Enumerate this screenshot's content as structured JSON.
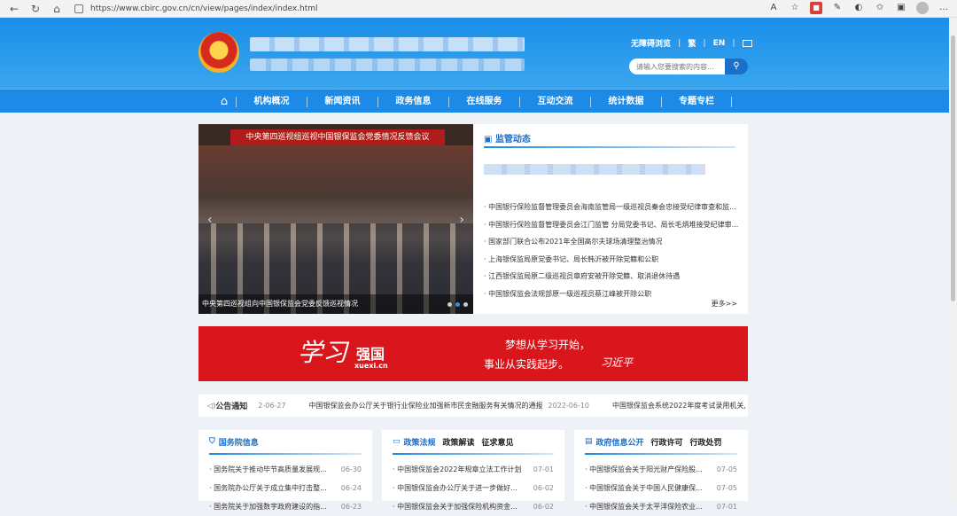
{
  "browser": {
    "url": "https://www.cbirc.gov.cn/cn/view/pages/index/index.html",
    "icons": [
      "back-icon",
      "refresh-icon",
      "home-icon",
      "lock-icon",
      "read-aloud-icon",
      "favorite-icon",
      "pdf-icon",
      "collections-icon",
      "extensions-icon",
      "favorites-bar-icon",
      "sidebar-icon",
      "profile-icon",
      "more-icon"
    ]
  },
  "header": {
    "top_links": [
      "无障碍浏览",
      "繁",
      "EN"
    ],
    "search_placeholder": "请输入您要搜索的内容..."
  },
  "nav": {
    "items": [
      "机构概况",
      "新闻资讯",
      "政务信息",
      "在线服务",
      "互动交流",
      "统计数据",
      "专题专栏"
    ]
  },
  "slider": {
    "banner": "中央第四巡视组巡视中国银保监会党委情况反馈会议",
    "caption": "中央第四巡视组向中国银保监会党委反馈巡视情况"
  },
  "news": {
    "title": "监管动态",
    "items": [
      "中国银行保险监督管理委员会海南监管局一级巡视员秦会忠接受纪律审查和监...",
      "中国银行保险监督管理委员会江门监管 分局党委书记、局长毛炳堆接受纪律审...",
      "国家部门联合公布2021年全国高尔夫球场清理整治情况",
      "上海银保监局原党委书记、局长韩沂被开除党籍和公职",
      "江西银保监局原二级巡视员章府安被开除党籍、取消退休待遇",
      "中国银保监会法规部原一级巡视员蔡江峰被开除公职"
    ],
    "more": "更多>>"
  },
  "xuexi": {
    "brand": "学习强国",
    "brand_cn": "学习",
    "strong": "强国",
    "url": "xuexi.cn",
    "line1": "梦想从学习开始，",
    "line2": "事业从实践起步。",
    "signature": "习近平"
  },
  "notice": {
    "label": "公告通知",
    "partial_date": "2-06-27",
    "item1": "中国银保监会办公厅关于银行业保险业加强新市民金融服务有关情况的通报",
    "item1_date": "2022-06-10",
    "item2": "中国银保监会系统2022年度考试录用机关,"
  },
  "columns": [
    {
      "title": "国务院信息",
      "tabs": [],
      "items": [
        {
          "t": "国务院关于推动毕节高质量发展规...",
          "d": "06-30"
        },
        {
          "t": "国务院办公厅关于成立集中打击整...",
          "d": "06-24"
        },
        {
          "t": "国务院关于加强数字政府建设的指...",
          "d": "06-23"
        }
      ]
    },
    {
      "title": "政策法规",
      "tabs": [
        "政策解读",
        "征求意见"
      ],
      "items": [
        {
          "t": "中国银保监会2022年规章立法工作计划",
          "d": "07-01"
        },
        {
          "t": "中国银保监会办公厅关于进一步做好...",
          "d": "06-02"
        },
        {
          "t": "中国银保监会关于加强保险机构资金...",
          "d": "06-02"
        }
      ]
    },
    {
      "title": "政府信息公开",
      "tabs": [
        "行政许可",
        "行政处罚"
      ],
      "items": [
        {
          "t": "中国银保监会关于阳光财产保险股...",
          "d": "07-05"
        },
        {
          "t": "中国银保监会关于中国人民健康保...",
          "d": "07-05"
        },
        {
          "t": "中国银保监会关于太平洋保险农业...",
          "d": "07-01"
        }
      ]
    }
  ]
}
